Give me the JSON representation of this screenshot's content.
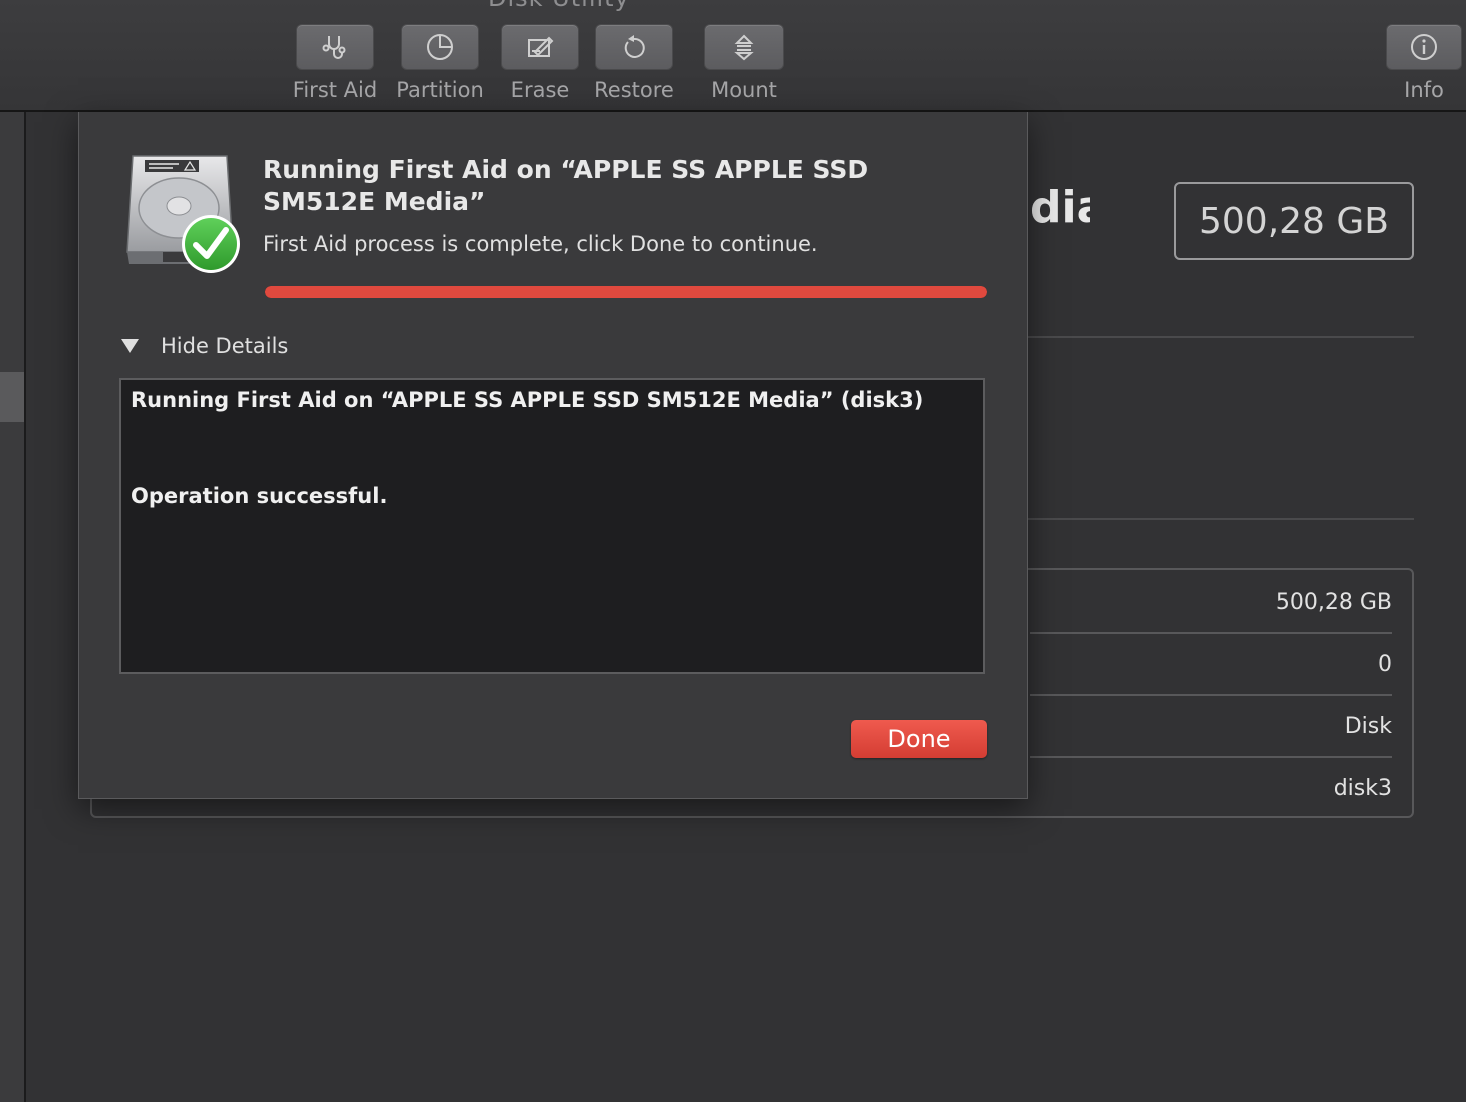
{
  "window": {
    "title": "Disk Utility"
  },
  "toolbar": {
    "first_aid": {
      "label": "First Aid",
      "icon": "stethoscope-icon"
    },
    "partition": {
      "label": "Partition",
      "icon": "pie-chart-icon"
    },
    "erase": {
      "label": "Erase",
      "icon": "eraser-icon"
    },
    "restore": {
      "label": "Restore",
      "icon": "restore-arrow-icon"
    },
    "mount": {
      "label": "Mount",
      "icon": "mount-icon"
    },
    "info": {
      "label": "Info",
      "icon": "info-icon"
    }
  },
  "background": {
    "title_fragment": "dia",
    "capacity": "500,28 GB",
    "info_rows": [
      "500,28 GB",
      "0",
      "Disk",
      "disk3"
    ]
  },
  "sheet": {
    "title": "Running First Aid on “APPLE SS APPLE SSD SM512E Media”",
    "status": "First Aid process is complete, click Done to continue.",
    "progress_percent": 100,
    "details_toggle_label": "Hide Details",
    "log_lines": [
      "Running First Aid on “APPLE SS APPLE SSD SM512E Media” (disk3)",
      "Operation successful."
    ],
    "done_label": "Done",
    "accent_color": "#e0493e",
    "check_color": "#3fb43c"
  }
}
